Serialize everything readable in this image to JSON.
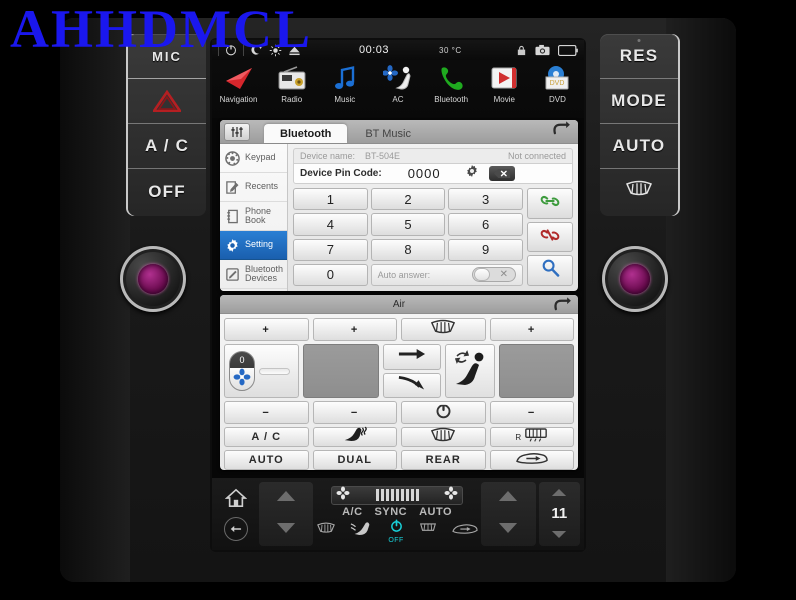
{
  "watermark": "AHHDMCL",
  "hardware": {
    "left_buttons": [
      {
        "label": "MIC",
        "name": "mic-button"
      },
      {
        "label": "",
        "name": "hazard-button",
        "icon": "hazard-triangle-icon"
      },
      {
        "label": "A / C",
        "name": "ac-button"
      },
      {
        "label": "OFF",
        "name": "off-button"
      }
    ],
    "right_buttons": [
      {
        "label": "RES",
        "name": "res-button"
      },
      {
        "label": "MODE",
        "name": "mode-button"
      },
      {
        "label": "AUTO",
        "name": "auto-button"
      },
      {
        "label": "",
        "name": "rear-defrost-button",
        "icon": "defrost-icon"
      }
    ],
    "knob_left": "volume-knob",
    "knob_right": "tune-knob"
  },
  "statusbar": {
    "power_icon": "power-icon",
    "night_icon": "moon-icon",
    "brightness_icon": "sun-icon",
    "eject_icon": "eject-icon",
    "time": "00:03",
    "temperature": "30 °C",
    "lock_icon": "lock-icon",
    "camera_icon": "camera-icon",
    "battery_icon": "battery-icon"
  },
  "apps": [
    {
      "label": "Navigation",
      "icon": "navigation-arrow-icon"
    },
    {
      "label": "Radio",
      "icon": "radio-icon"
    },
    {
      "label": "Music",
      "icon": "music-note-icon"
    },
    {
      "label": "AC",
      "icon": "ac-fan-seat-icon"
    },
    {
      "label": "Bluetooth",
      "icon": "phone-handset-icon"
    },
    {
      "label": "Movie",
      "icon": "play-button-icon"
    },
    {
      "label": "DVD",
      "icon": "dvd-disc-icon"
    }
  ],
  "bluetooth": {
    "eq_icon": "equalizer-icon",
    "back_icon": "back-arrow-icon",
    "tabs": [
      {
        "label": "Bluetooth",
        "active": true
      },
      {
        "label": "BT Music",
        "active": false
      }
    ],
    "sidebar": [
      {
        "label": "Keypad",
        "icon": "dialpad-icon",
        "selected": false
      },
      {
        "label": "Recents",
        "icon": "recents-edit-icon",
        "selected": false
      },
      {
        "label": "Phone Book",
        "icon": "phonebook-icon",
        "selected": false
      },
      {
        "label": "Setting",
        "icon": "gear-icon",
        "selected": true
      },
      {
        "label": "Bluetooth Devices",
        "icon": "pen-icon",
        "selected": false
      }
    ],
    "device_name_label": "Device name:",
    "device_name_value": "BT-504E",
    "connection_status": "Not connected",
    "pin_label": "Device Pin Code:",
    "pin_value": "0000",
    "pin_gear_icon": "gear-icon",
    "pin_backspace_icon": "backspace-icon",
    "keys": [
      "1",
      "2",
      "3",
      "4",
      "5",
      "6",
      "7",
      "8",
      "9",
      "0"
    ],
    "auto_answer_label": "Auto answer:",
    "auto_answer_state": "off",
    "side_actions": [
      {
        "icon": "link-connect-icon",
        "color": "#3d9b3d"
      },
      {
        "icon": "link-broken-disconnect-icon",
        "color": "#b02a2a"
      },
      {
        "icon": "search-magnifier-icon",
        "color": "#2f6fc0"
      }
    ]
  },
  "air": {
    "title": "Air",
    "back_icon": "back-arrow-icon",
    "top_row": [
      {
        "label": "+",
        "name": "driver-temp-up"
      },
      {
        "label": "+",
        "name": "fan-up"
      },
      {
        "label": "",
        "name": "front-defrost-toggle",
        "icon": "defrost-icon"
      },
      {
        "label": "+",
        "name": "passenger-temp-up"
      }
    ],
    "fan_slider_value": "0",
    "fan_slider_icon": "fan-icon",
    "airflow_icons": [
      "arrow-right-icon",
      "arrow-curve-down-icon"
    ],
    "seat_icon": "seat-recirculation-icon",
    "minus_row": [
      {
        "label": "−",
        "name": "driver-temp-down"
      },
      {
        "label": "−",
        "name": "fan-down"
      },
      {
        "label": "",
        "name": "air-power-button",
        "icon": "power-icon"
      },
      {
        "label": "−",
        "name": "passenger-temp-down"
      }
    ],
    "label_row_1": [
      {
        "label": "A / C",
        "name": "ac-toggle"
      },
      {
        "label": "",
        "name": "seat-heat-toggle",
        "icon": "seat-heat-icon"
      },
      {
        "label": "",
        "name": "front-defrost-button",
        "icon": "defrost-icon"
      },
      {
        "label": "R",
        "name": "rear-defrost-toggle",
        "icon": "rear-defrost-icon"
      }
    ],
    "label_row_2": [
      {
        "label": "AUTO",
        "name": "auto-toggle"
      },
      {
        "label": "DUAL",
        "name": "dual-toggle"
      },
      {
        "label": "REAR",
        "name": "rear-toggle"
      },
      {
        "label": "",
        "name": "recirculation-toggle",
        "icon": "car-recirculation-icon"
      }
    ]
  },
  "bottombar": {
    "home_icon": "home-icon",
    "back_icon": "back-circle-icon",
    "left_up_icon": "chevron-up-icon",
    "left_down_icon": "chevron-down-icon",
    "fan_left_icon": "fan-icon",
    "fan_right_icon": "fan-icon",
    "fan_bars": 9,
    "labels": [
      "A/C",
      "SYNC",
      "AUTO"
    ],
    "defrost_icon": "defrost-icon",
    "seat_icon": "seat-airflow-icon",
    "power_state": "OFF",
    "power_icon": "power-icon",
    "rear_defrost_icon": "rear-defrost-icon",
    "recirc_icon": "car-recirculation-icon",
    "right_up_icon": "chevron-up-icon",
    "right_down_icon": "chevron-down-icon",
    "temp_value": "11",
    "temp_up_icon": "chevron-up-icon",
    "temp_down_icon": "chevron-down-icon"
  }
}
